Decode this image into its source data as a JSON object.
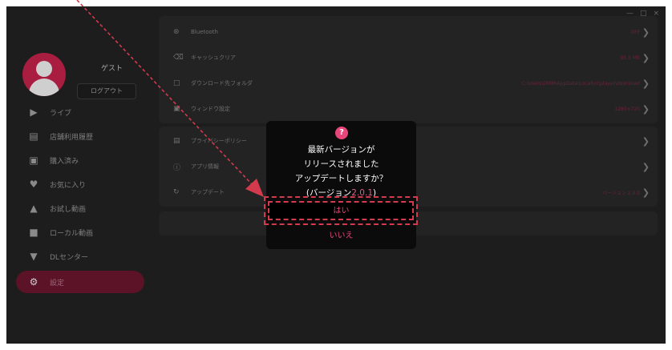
{
  "window": {
    "controls": [
      "—",
      "□",
      "×"
    ]
  },
  "sidebar": {
    "guest_name": "ゲスト",
    "login_label": "ログアウト",
    "items": [
      {
        "label": "ライブ",
        "icon": "live-icon"
      },
      {
        "label": "店舗利用履歴",
        "icon": "history-icon"
      },
      {
        "label": "購入済み",
        "icon": "cart-icon"
      },
      {
        "label": "お気に入り",
        "icon": "heart-icon"
      },
      {
        "label": "お試し動画",
        "icon": "trial-icon"
      },
      {
        "label": "ローカル動画",
        "icon": "local-video-icon"
      },
      {
        "label": "DLセンター",
        "icon": "download-icon"
      },
      {
        "label": "設定",
        "icon": "settings-icon"
      }
    ]
  },
  "settings": {
    "rows_top": [
      {
        "label": "Bluetooth",
        "value": "OFF",
        "icon": "bluetooth-icon"
      },
      {
        "label": "キャッシュクリア",
        "value": "95.5 MB",
        "icon": "trash-icon"
      },
      {
        "label": "ダウンロード先フォルダ",
        "value": "C:\\Users\\DMM\\AppData\\Local\\vr\\player\\download",
        "icon": "folder-icon"
      },
      {
        "label": "ウィンドウ設定",
        "value": "1280×720",
        "icon": "window-icon"
      }
    ],
    "rows_bottom": [
      {
        "label": "プライバシーポリシー",
        "value": "",
        "icon": "policy-icon"
      },
      {
        "label": "アプリ情報",
        "value": "",
        "icon": "info-icon"
      },
      {
        "label": "アップデート",
        "value": "バージョン 2.0.0",
        "icon": "update-icon"
      }
    ]
  },
  "dialog": {
    "icon": "question-icon",
    "line1": "最新バージョンが",
    "line2": "リリースされました",
    "line3": "アップデートしますか？",
    "version_prefix": "(バージョン",
    "version_number": "2.0.1",
    "version_suffix": ")",
    "yes_label": "はい",
    "no_label": "いいえ"
  },
  "colors": {
    "accent": "#e8457a",
    "highlight": "#d33a4d"
  }
}
